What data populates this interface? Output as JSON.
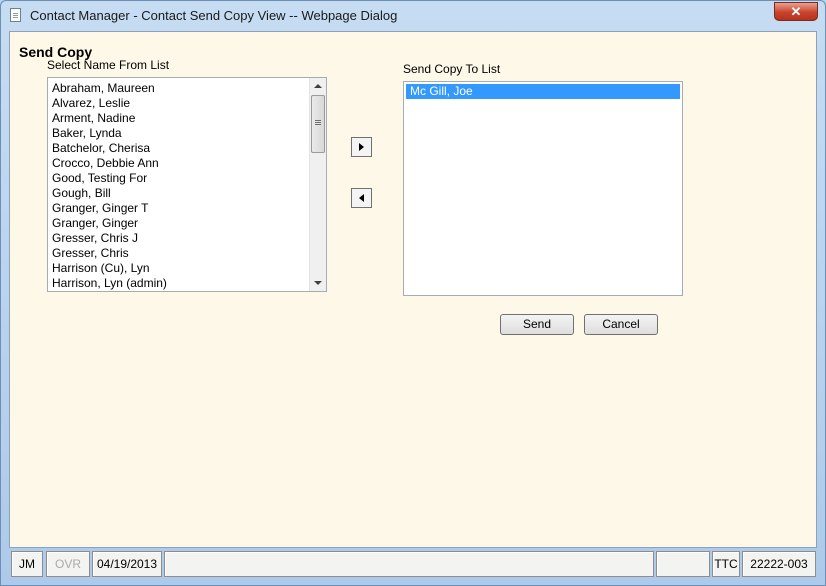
{
  "window": {
    "title": "Contact Manager - Contact Send Copy View -- Webpage Dialog",
    "close_label": "✕"
  },
  "form": {
    "heading": "Send Copy",
    "from_label": "Select Name From List",
    "to_label": "Send Copy To List",
    "from_list": [
      "Abraham, Maureen",
      "Alvarez, Leslie",
      "Arment, Nadine",
      "Baker, Lynda",
      "Batchelor, Cherisa",
      "Crocco, Debbie Ann",
      "Good, Testing For",
      "Gough, Bill",
      "Granger, Ginger T",
      "Granger, Ginger",
      "Gresser, Chris J",
      "Gresser, Chris",
      "Harrison (Cu), Lyn",
      "Harrison, Lyn (admin)"
    ],
    "to_list": [
      "Mc Gill, Joe"
    ],
    "send_label": "Send",
    "cancel_label": "Cancel",
    "add_icon": "triangle-right-icon",
    "remove_icon": "triangle-left-icon"
  },
  "statusbar": {
    "user": "JM",
    "mode": "OVR",
    "date": "04/19/2013",
    "blank1": "",
    "blank2": "",
    "company": "TTC",
    "code": "22222-003"
  },
  "colors": {
    "client_bg": "#fdf8e7",
    "selection": "#3399ff",
    "close_button": "#c7432c",
    "frame": "#b9d1ea"
  }
}
